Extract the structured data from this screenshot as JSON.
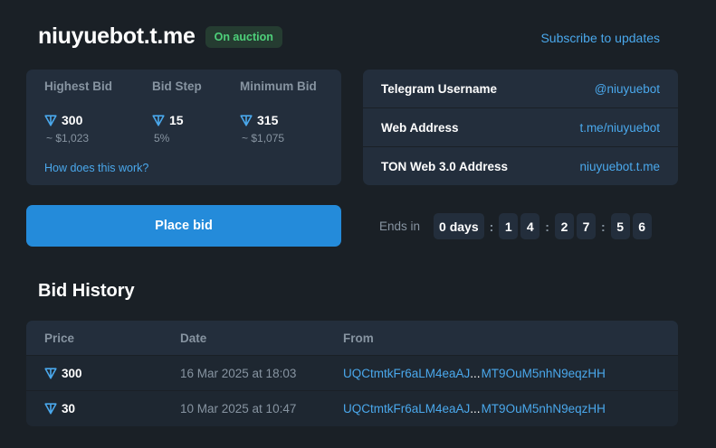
{
  "header": {
    "title": "niuyuebot.t.me",
    "status": "On auction",
    "subscribe": "Subscribe to updates"
  },
  "bids": {
    "highest": {
      "label": "Highest Bid",
      "value": "300",
      "sub": "~ $1,023"
    },
    "step": {
      "label": "Bid Step",
      "value": "15",
      "sub": "5%"
    },
    "minimum": {
      "label": "Minimum Bid",
      "value": "315",
      "sub": "~ $1,075"
    },
    "how_link": "How does this work?"
  },
  "info": [
    {
      "key": "Telegram Username",
      "value": "@niuyuebot"
    },
    {
      "key": "Web Address",
      "value": "t.me/niuyuebot"
    },
    {
      "key": "TON Web 3.0 Address",
      "value": "niuyuebot.t.me"
    }
  ],
  "place_bid": "Place bid",
  "countdown": {
    "label": "Ends in",
    "days": "0 days",
    "hours": [
      "1",
      "4"
    ],
    "minutes": [
      "2",
      "7"
    ],
    "seconds": [
      "5",
      "6"
    ]
  },
  "history": {
    "title": "Bid History",
    "columns": [
      "Price",
      "Date",
      "From"
    ],
    "rows": [
      {
        "price": "300",
        "date": "16 Mar 2025 at 18:03",
        "from_start": "UQCtmtkFr6aLM4eaAJ",
        "from_dots": "...",
        "from_end": "MT9OuM5nhN9eqzHH"
      },
      {
        "price": "30",
        "date": "10 Mar 2025 at 10:47",
        "from_start": "UQCtmtkFr6aLM4eaAJ",
        "from_dots": "...",
        "from_end": "MT9OuM5nhN9eqzHH"
      }
    ]
  },
  "colors": {
    "background": "#1a2026",
    "card": "#232e3c",
    "accent": "#248bda",
    "link": "#4aa8ec",
    "badge_green": "#4ed07a"
  },
  "icons": {
    "currency": "ton-diamond-icon"
  }
}
